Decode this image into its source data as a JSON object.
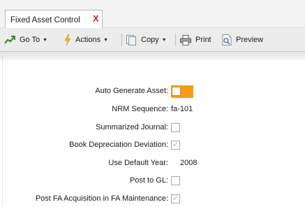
{
  "tab": {
    "title": "Fixed Asset Control",
    "close_glyph": "X"
  },
  "toolbar": {
    "goto_label": "Go To",
    "actions_label": "Actions",
    "copy_label": "Copy",
    "print_label": "Print",
    "preview_label": "Preview"
  },
  "form": {
    "auto_generate_label": "Auto Generate Asset:",
    "auto_generate_checked": false,
    "nrm_label": "NRM Sequence:",
    "nrm_value": "fa-101",
    "summarized_label": "Summarized Journal:",
    "summarized_checked": false,
    "book_dep_label": "Book Depreciation Deviation:",
    "book_dep_checked": true,
    "default_year_label": "Use Default Year:",
    "default_year_value": "2008",
    "post_gl_label": "Post to GL:",
    "post_gl_checked": false,
    "post_fa_label": "Post FA Acquisition in FA Maintenance:",
    "post_fa_checked": true
  },
  "colors": {
    "accent_orange": "#f59a1b",
    "close_red": "#d62020",
    "check_mark": "#9db6d6"
  }
}
